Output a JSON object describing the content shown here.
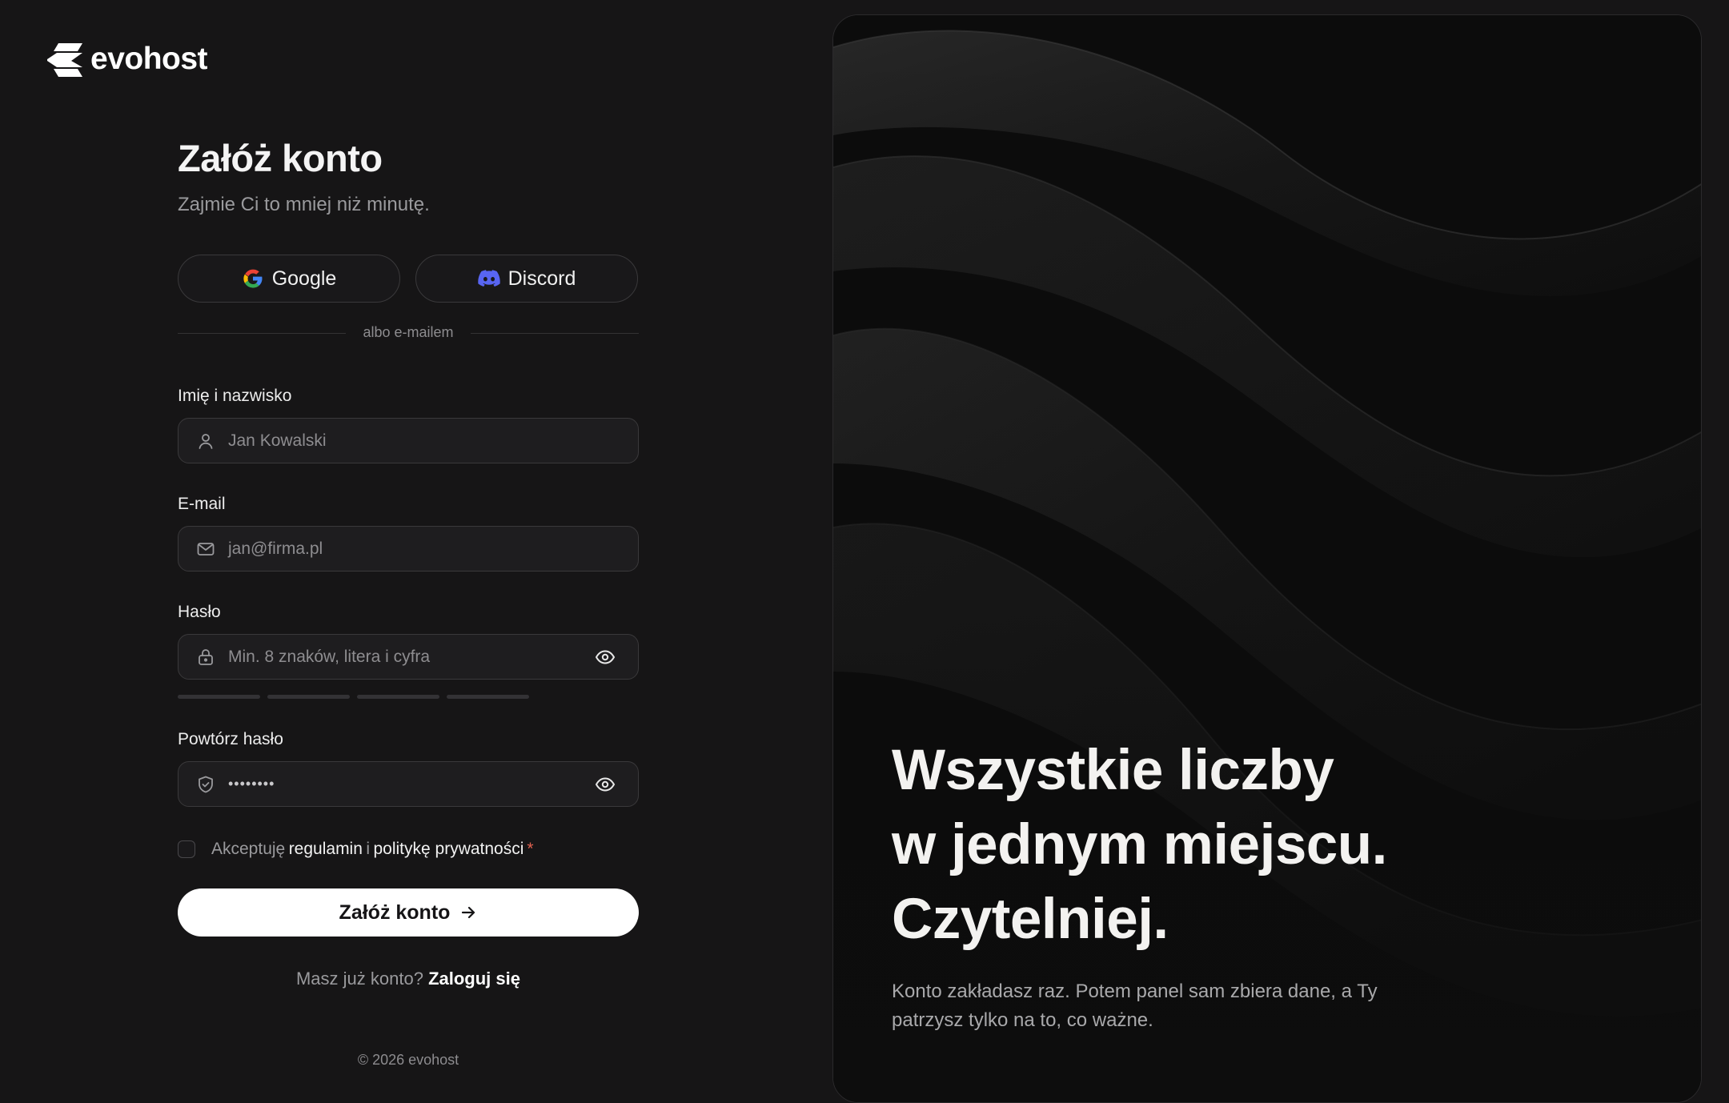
{
  "brand": {
    "name": "evohost"
  },
  "form": {
    "title": "Załóż konto",
    "subtitle": "Zajmie Ci to mniej niż minutę.",
    "social": {
      "google": "Google",
      "discord": "Discord"
    },
    "divider": "albo e-mailem",
    "fields": {
      "name": {
        "label": "Imię i nazwisko",
        "placeholder": "Jan Kowalski",
        "icon": "user-icon"
      },
      "email": {
        "label": "E-mail",
        "placeholder": "jan@firma.pl",
        "icon": "mail-icon"
      },
      "password": {
        "label": "Hasło",
        "placeholder": "Min. 8 znaków, litera i cyfra",
        "icon": "lock-icon"
      },
      "password_repeat": {
        "label": "Powtórz hasło",
        "value": "••••••••",
        "icon": "shield-icon"
      }
    },
    "password_strength_segments_filled": 0,
    "terms": {
      "prefix": "Akceptuję",
      "link1": "regulamin",
      "mid": "i",
      "link2": "politykę prywatności",
      "required": "*",
      "checked": false
    },
    "submit": "Załóż konto",
    "signin": {
      "question": "Masz już konto?",
      "link": "Zaloguj się"
    }
  },
  "footer": {
    "copyright": "© 2026 evohost"
  },
  "hero": {
    "headline": [
      "Wszystkie liczby",
      "w jednym miejscu.",
      "Czytelniej."
    ],
    "description": "Konto zakładasz raz. Potem panel sam zbiera dane, a Ty patrzysz tylko na to, co ważne."
  },
  "colors": {
    "background": "#161516",
    "button": "#ffffff",
    "required": "#e0614f",
    "discord": "#5865F2"
  }
}
